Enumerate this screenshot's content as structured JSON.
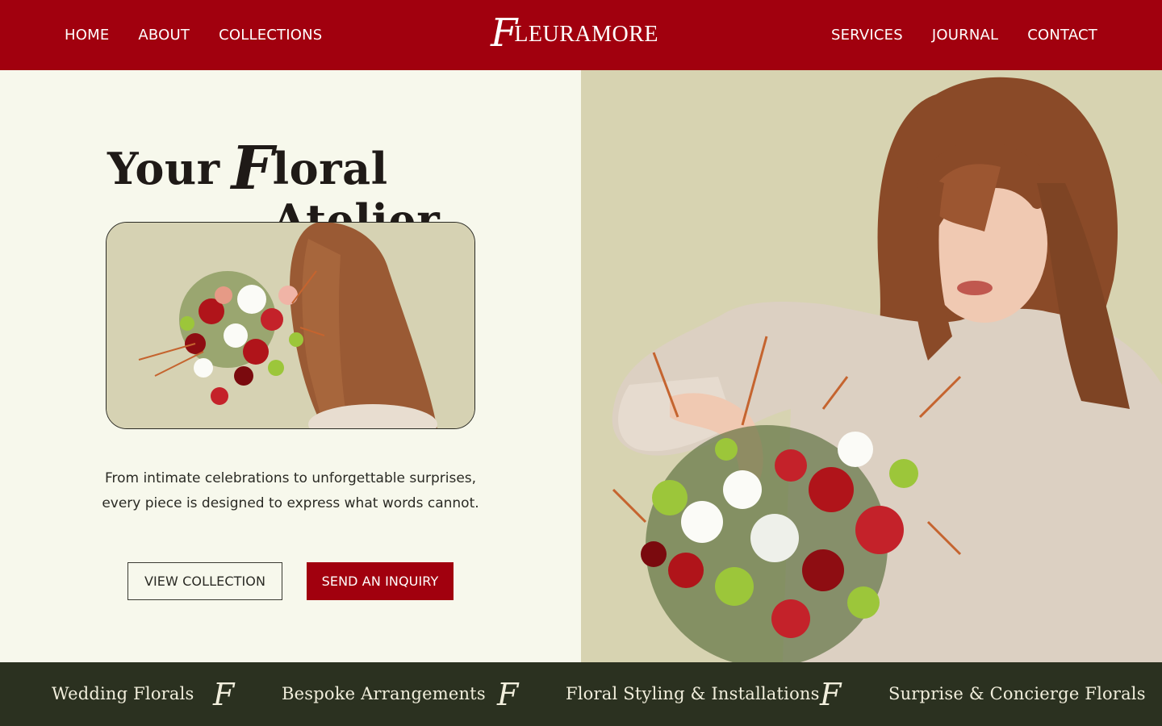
{
  "header": {
    "nav_left": [
      {
        "label": "HOME"
      },
      {
        "label": "ABOUT"
      },
      {
        "label": "COLLECTIONS"
      }
    ],
    "nav_right": [
      {
        "label": "SERVICES"
      },
      {
        "label": "JOURNAL"
      },
      {
        "label": "CONTACT"
      }
    ],
    "logo": {
      "initial": "F",
      "word": "LEURAMORE"
    }
  },
  "hero": {
    "headline_before": "Your",
    "headline_script": "F",
    "headline_after": "loral Atelier",
    "intro_line1": "From intimate celebrations to unforgettable surprises,",
    "intro_line2": "every piece is designed to express what words cannot.",
    "cta_primary": "VIEW COLLECTION",
    "cta_secondary": "SEND AN INQUIRY"
  },
  "ribbon": {
    "items": [
      "Wedding Florals",
      "Bespoke Arrangements",
      "Floral Styling & Installations",
      "Surprise & Concierge Florals"
    ],
    "mark": "F"
  },
  "colors": {
    "brand_red": "#a1000e",
    "cream": "#f7f8ec",
    "sage": "#d7d3b1",
    "ribbon_dark": "#2b3120"
  }
}
